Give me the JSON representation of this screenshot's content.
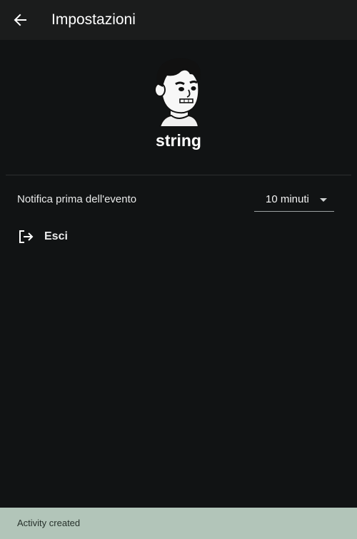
{
  "header": {
    "title": "Impostazioni",
    "back_icon": "arrow-left-icon"
  },
  "profile": {
    "username": "string",
    "avatar_icon": "cartoon-avatar-icon"
  },
  "settings": {
    "notification_label": "Notifica prima dell'evento",
    "notification_value": "10 minuti",
    "dropdown_icon": "caret-down-icon"
  },
  "logout": {
    "label": "Esci",
    "icon": "logout-icon"
  },
  "snackbar": {
    "message": "Activity created"
  },
  "colors": {
    "background": "#111314",
    "topbar": "#1b1c1c",
    "snackbar": "#b2c5b9",
    "text": "#ffffff"
  }
}
